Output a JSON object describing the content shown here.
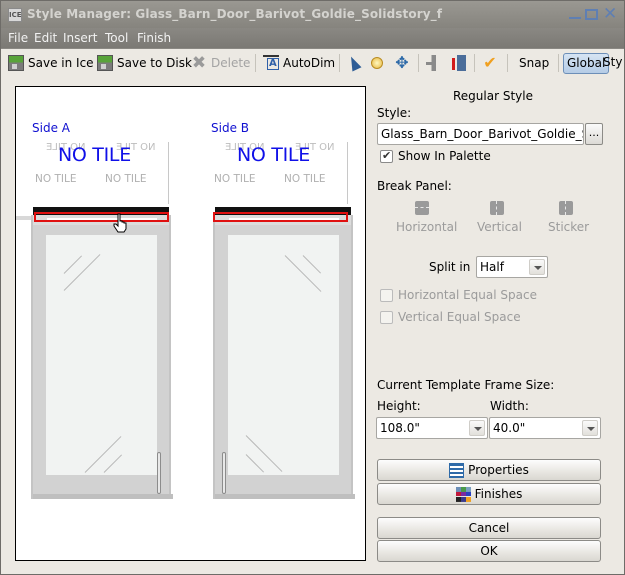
{
  "window": {
    "title": "Style Manager: Glass_Barn_Door_Barivot_Goldie_Solidstory_f",
    "app_icon_label": "ICE"
  },
  "menu": [
    "File",
    "Edit",
    "Insert",
    "Tool",
    "Finish"
  ],
  "toolbar": {
    "save_in_ice": "Save in Ice",
    "save_to_disk": "Save to Disk",
    "delete": "Delete",
    "autodim": "AutoDim",
    "snap": "Snap",
    "global": "Global",
    "style_cut": "Sty"
  },
  "canvas": {
    "side_a_label": "Side A",
    "side_b_label": "Side B",
    "no_tile": "NO TILE"
  },
  "panel": {
    "heading": "Regular Style",
    "style_label": "Style:",
    "style_value": "Glass_Barn_Door_Barivot_Goldie_Solidstory_f",
    "browse_label": "...",
    "show_in_palette_label": "Show In Palette",
    "show_in_palette_checked": true,
    "break_panel_label": "Break Panel:",
    "break_options": [
      "Horizontal",
      "Vertical",
      "Sticker"
    ],
    "split_in_label": "Split in",
    "split_in_value": "Half",
    "horizontal_equal_space_label": "Horizontal Equal Space",
    "vertical_equal_space_label": "Vertical Equal Space",
    "frame_size_label": "Current Template Frame Size:",
    "height_label": "Height:",
    "width_label": "Width:",
    "height_value": "108.0\"",
    "width_value": "40.0\"",
    "properties_label": "Properties",
    "finishes_label": "Finishes",
    "cancel_label": "Cancel",
    "ok_label": "OK"
  },
  "colors": {
    "selection": "#e01010",
    "side_label": "#1010d0",
    "no_tile_primary": "#1010e8"
  }
}
